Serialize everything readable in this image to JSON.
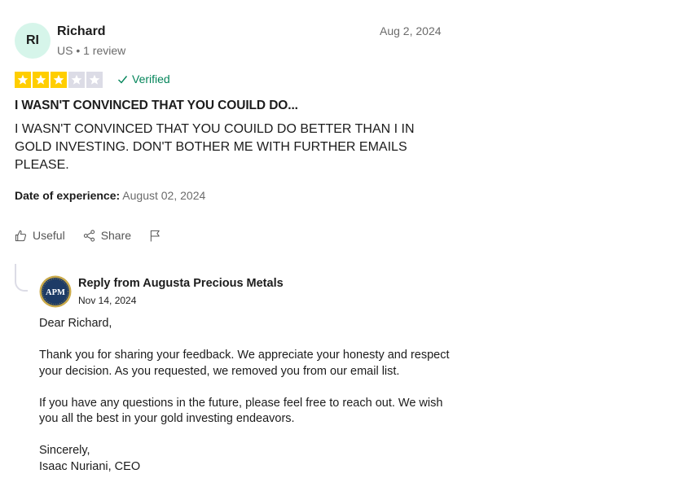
{
  "reviewer": {
    "initials": "RI",
    "name": "Richard",
    "meta": "US • 1 review"
  },
  "review": {
    "date": "Aug 2, 2024",
    "rating": 3,
    "rating_max": 5,
    "verified_label": "Verified",
    "title": "I WASN'T CONVINCED THAT YOU COUILD DO...",
    "text": "I WASN'T CONVINCED THAT YOU COUILD DO BETTER THAN I IN GOLD INVESTING. DON'T BOTHER ME WITH FURTHER EMAILS PLEASE.",
    "experience_label": "Date of experience:",
    "experience_date": "August 02, 2024"
  },
  "actions": {
    "useful_label": "Useful",
    "share_label": "Share"
  },
  "reply": {
    "logo_text": "APM",
    "from": "Reply from Augusta Precious Metals",
    "date": "Nov 14, 2024",
    "paragraphs": [
      "Dear Richard,",
      "Thank you for sharing your feedback. We appreciate your honesty and respect your decision. As you requested, we removed you from our email list.",
      "If you have any questions in the future, please feel free to reach out. We wish you all the best in your gold investing endeavors.",
      "Sincerely,\nIsaac Nuriani, CEO"
    ]
  },
  "colors": {
    "star_on": "#ffce00",
    "star_off": "#dcdce6",
    "verified": "#04855a",
    "avatar_bg": "#d6f5ea"
  }
}
